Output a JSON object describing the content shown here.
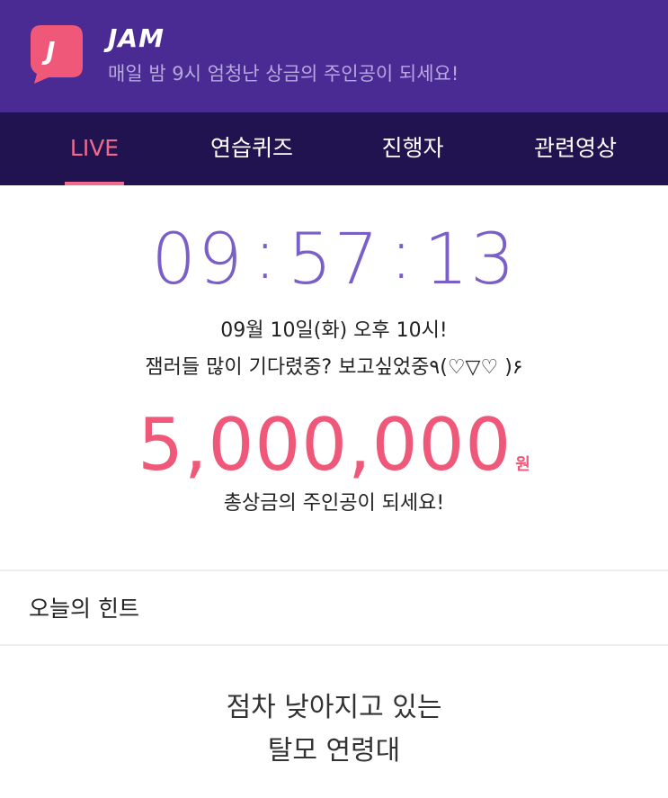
{
  "header": {
    "app_name": "JAM",
    "logo_letter": "J",
    "subtitle": "매일 밤 9시 엄청난 상금의 주인공이 되세요!",
    "colors": {
      "background": "#4a2a93",
      "logo": "#f0587a"
    }
  },
  "tabs": [
    {
      "label": "LIVE",
      "active": true
    },
    {
      "label": "연습퀴즈",
      "active": false
    },
    {
      "label": "진행자",
      "active": false
    },
    {
      "label": "관련영상",
      "active": false
    }
  ],
  "countdown": {
    "hours": "09",
    "minutes": "57",
    "seconds": "13",
    "separator": ":"
  },
  "schedule": {
    "date_line": "09월 10일(화) 오후 10시!",
    "message": "잼러들 많이 기다렸중? 보고싶었중٩(♡▽♡ )۶"
  },
  "prize": {
    "amount": "5,000,000",
    "unit": "원",
    "caption": "총상금의 주인공이 되세요!"
  },
  "hint": {
    "heading": "오늘의 힌트",
    "lines": [
      "점차 낮아지고 있는",
      "탈모 연령대"
    ]
  }
}
